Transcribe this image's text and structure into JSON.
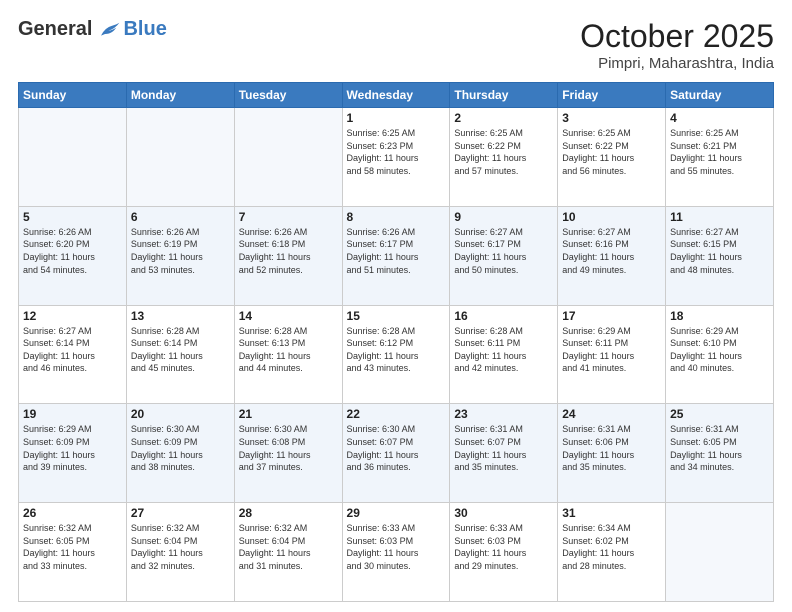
{
  "header": {
    "logo_general": "General",
    "logo_blue": "Blue",
    "title": "October 2025",
    "location": "Pimpri, Maharashtra, India"
  },
  "days_of_week": [
    "Sunday",
    "Monday",
    "Tuesday",
    "Wednesday",
    "Thursday",
    "Friday",
    "Saturday"
  ],
  "weeks": [
    [
      {
        "day": "",
        "info": ""
      },
      {
        "day": "",
        "info": ""
      },
      {
        "day": "",
        "info": ""
      },
      {
        "day": "1",
        "info": "Sunrise: 6:25 AM\nSunset: 6:23 PM\nDaylight: 11 hours\nand 58 minutes."
      },
      {
        "day": "2",
        "info": "Sunrise: 6:25 AM\nSunset: 6:22 PM\nDaylight: 11 hours\nand 57 minutes."
      },
      {
        "day": "3",
        "info": "Sunrise: 6:25 AM\nSunset: 6:22 PM\nDaylight: 11 hours\nand 56 minutes."
      },
      {
        "day": "4",
        "info": "Sunrise: 6:25 AM\nSunset: 6:21 PM\nDaylight: 11 hours\nand 55 minutes."
      }
    ],
    [
      {
        "day": "5",
        "info": "Sunrise: 6:26 AM\nSunset: 6:20 PM\nDaylight: 11 hours\nand 54 minutes."
      },
      {
        "day": "6",
        "info": "Sunrise: 6:26 AM\nSunset: 6:19 PM\nDaylight: 11 hours\nand 53 minutes."
      },
      {
        "day": "7",
        "info": "Sunrise: 6:26 AM\nSunset: 6:18 PM\nDaylight: 11 hours\nand 52 minutes."
      },
      {
        "day": "8",
        "info": "Sunrise: 6:26 AM\nSunset: 6:17 PM\nDaylight: 11 hours\nand 51 minutes."
      },
      {
        "day": "9",
        "info": "Sunrise: 6:27 AM\nSunset: 6:17 PM\nDaylight: 11 hours\nand 50 minutes."
      },
      {
        "day": "10",
        "info": "Sunrise: 6:27 AM\nSunset: 6:16 PM\nDaylight: 11 hours\nand 49 minutes."
      },
      {
        "day": "11",
        "info": "Sunrise: 6:27 AM\nSunset: 6:15 PM\nDaylight: 11 hours\nand 48 minutes."
      }
    ],
    [
      {
        "day": "12",
        "info": "Sunrise: 6:27 AM\nSunset: 6:14 PM\nDaylight: 11 hours\nand 46 minutes."
      },
      {
        "day": "13",
        "info": "Sunrise: 6:28 AM\nSunset: 6:14 PM\nDaylight: 11 hours\nand 45 minutes."
      },
      {
        "day": "14",
        "info": "Sunrise: 6:28 AM\nSunset: 6:13 PM\nDaylight: 11 hours\nand 44 minutes."
      },
      {
        "day": "15",
        "info": "Sunrise: 6:28 AM\nSunset: 6:12 PM\nDaylight: 11 hours\nand 43 minutes."
      },
      {
        "day": "16",
        "info": "Sunrise: 6:28 AM\nSunset: 6:11 PM\nDaylight: 11 hours\nand 42 minutes."
      },
      {
        "day": "17",
        "info": "Sunrise: 6:29 AM\nSunset: 6:11 PM\nDaylight: 11 hours\nand 41 minutes."
      },
      {
        "day": "18",
        "info": "Sunrise: 6:29 AM\nSunset: 6:10 PM\nDaylight: 11 hours\nand 40 minutes."
      }
    ],
    [
      {
        "day": "19",
        "info": "Sunrise: 6:29 AM\nSunset: 6:09 PM\nDaylight: 11 hours\nand 39 minutes."
      },
      {
        "day": "20",
        "info": "Sunrise: 6:30 AM\nSunset: 6:09 PM\nDaylight: 11 hours\nand 38 minutes."
      },
      {
        "day": "21",
        "info": "Sunrise: 6:30 AM\nSunset: 6:08 PM\nDaylight: 11 hours\nand 37 minutes."
      },
      {
        "day": "22",
        "info": "Sunrise: 6:30 AM\nSunset: 6:07 PM\nDaylight: 11 hours\nand 36 minutes."
      },
      {
        "day": "23",
        "info": "Sunrise: 6:31 AM\nSunset: 6:07 PM\nDaylight: 11 hours\nand 35 minutes."
      },
      {
        "day": "24",
        "info": "Sunrise: 6:31 AM\nSunset: 6:06 PM\nDaylight: 11 hours\nand 35 minutes."
      },
      {
        "day": "25",
        "info": "Sunrise: 6:31 AM\nSunset: 6:05 PM\nDaylight: 11 hours\nand 34 minutes."
      }
    ],
    [
      {
        "day": "26",
        "info": "Sunrise: 6:32 AM\nSunset: 6:05 PM\nDaylight: 11 hours\nand 33 minutes."
      },
      {
        "day": "27",
        "info": "Sunrise: 6:32 AM\nSunset: 6:04 PM\nDaylight: 11 hours\nand 32 minutes."
      },
      {
        "day": "28",
        "info": "Sunrise: 6:32 AM\nSunset: 6:04 PM\nDaylight: 11 hours\nand 31 minutes."
      },
      {
        "day": "29",
        "info": "Sunrise: 6:33 AM\nSunset: 6:03 PM\nDaylight: 11 hours\nand 30 minutes."
      },
      {
        "day": "30",
        "info": "Sunrise: 6:33 AM\nSunset: 6:03 PM\nDaylight: 11 hours\nand 29 minutes."
      },
      {
        "day": "31",
        "info": "Sunrise: 6:34 AM\nSunset: 6:02 PM\nDaylight: 11 hours\nand 28 minutes."
      },
      {
        "day": "",
        "info": ""
      }
    ]
  ]
}
